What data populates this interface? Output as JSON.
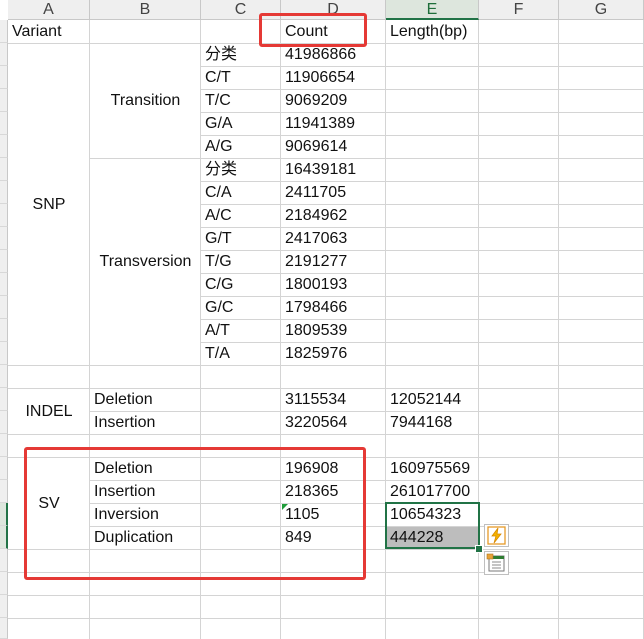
{
  "columns": [
    "A",
    "B",
    "C",
    "D",
    "E",
    "F",
    "G"
  ],
  "header": {
    "variant": "Variant",
    "count": "Count",
    "length": "Length(bp)"
  },
  "snp": {
    "label": "SNP",
    "transition": {
      "label": "Transition",
      "rows": [
        {
          "type": "分类",
          "count": "41986866"
        },
        {
          "type": "C/T",
          "count": "11906654"
        },
        {
          "type": "T/C",
          "count": "9069209"
        },
        {
          "type": "G/A",
          "count": "11941389"
        },
        {
          "type": "A/G",
          "count": "9069614"
        }
      ]
    },
    "transversion": {
      "label": "Transversion",
      "rows": [
        {
          "type": "分类",
          "count": "16439181"
        },
        {
          "type": "C/A",
          "count": "2411705"
        },
        {
          "type": "A/C",
          "count": "2184962"
        },
        {
          "type": "G/T",
          "count": "2417063"
        },
        {
          "type": "T/G",
          "count": "2191277"
        },
        {
          "type": "C/G",
          "count": "1800193"
        },
        {
          "type": "G/C",
          "count": "1798466"
        },
        {
          "type": "A/T",
          "count": "1809539"
        },
        {
          "type": "T/A",
          "count": "1825976"
        }
      ]
    }
  },
  "indel": {
    "label": "INDEL",
    "rows": [
      {
        "type": "Deletion",
        "count": "3115534",
        "length": "12052144"
      },
      {
        "type": "Insertion",
        "count": "3220564",
        "length": "7944168"
      }
    ]
  },
  "sv": {
    "label": "SV",
    "rows": [
      {
        "type": "Deletion",
        "count": "196908",
        "length": "160975569"
      },
      {
        "type": "Insertion",
        "count": "218365",
        "length": "261017700"
      },
      {
        "type": "Inversion",
        "count": "1105",
        "length": "10654323"
      },
      {
        "type": "Duplication",
        "count": "849",
        "length": "444228"
      }
    ]
  },
  "icons": {
    "quick_analysis": "lightning-icon",
    "paste_options": "paste-options-icon"
  },
  "colors": {
    "highlight": "#e53935",
    "selection": "#217346",
    "gridline": "#d4d4d4"
  }
}
